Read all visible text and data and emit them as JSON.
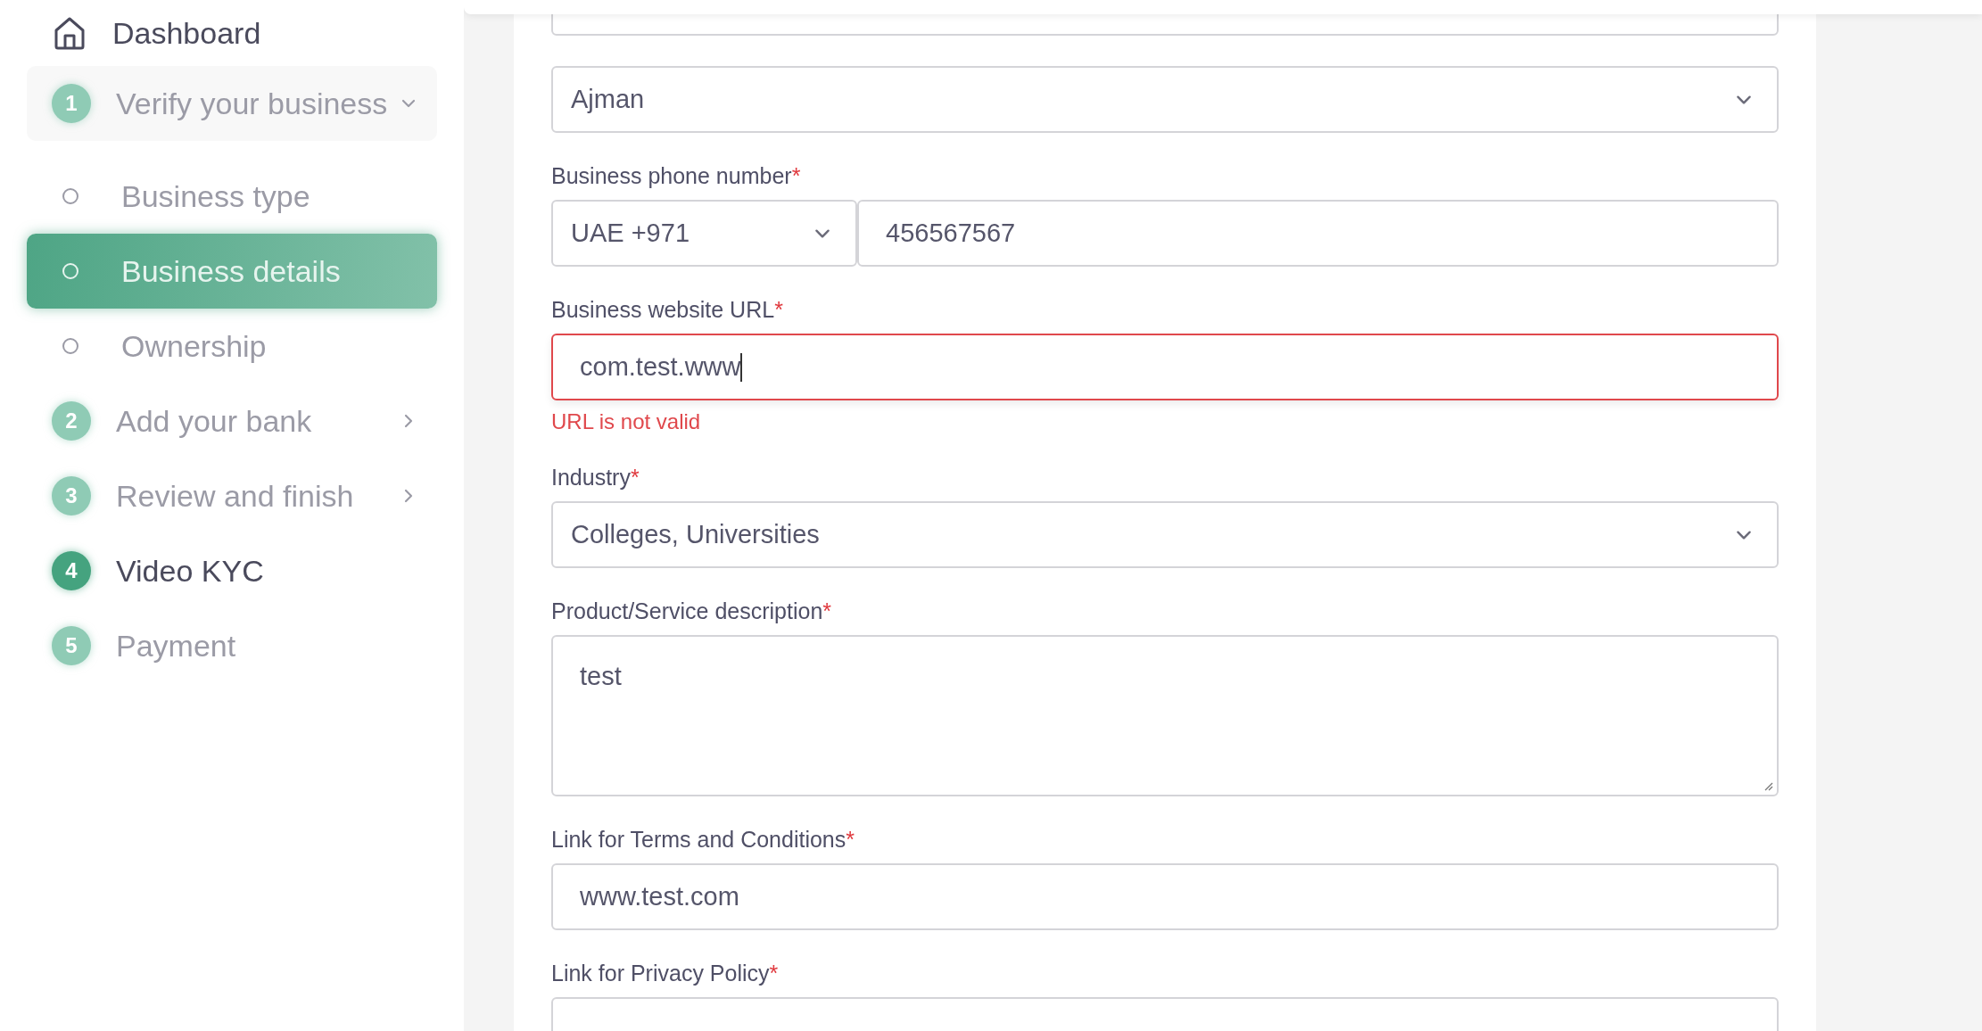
{
  "sidebar": {
    "dashboard": {
      "label": "Dashboard"
    },
    "steps": [
      {
        "kind": "group",
        "number": "1",
        "label": "Verify your business",
        "expanded": true,
        "active": false,
        "children": [
          {
            "label": "Business type",
            "selected": false
          },
          {
            "label": "Business details",
            "selected": true
          },
          {
            "label": "Ownership",
            "selected": false
          }
        ]
      },
      {
        "kind": "group",
        "number": "2",
        "label": "Add your bank",
        "expanded": false,
        "active": false
      },
      {
        "kind": "group",
        "number": "3",
        "label": "Review and finish",
        "expanded": false,
        "active": false
      },
      {
        "kind": "step",
        "number": "4",
        "label": "Video KYC",
        "active": true
      },
      {
        "kind": "step",
        "number": "5",
        "label": "Payment",
        "active": false
      }
    ]
  },
  "form": {
    "fields": [
      {
        "kind": "text"
      },
      {
        "kind": "select",
        "value": "Ajman"
      },
      {
        "kind": "phone",
        "label": "Business phone number",
        "required_mark": "*",
        "code": "UAE +971",
        "value": "456567567"
      },
      {
        "kind": "text",
        "label": "Business website URL",
        "required_mark": "*",
        "value": "com.test.www",
        "focused": true,
        "error": "URL is not valid"
      },
      {
        "kind": "select",
        "label": "Industry",
        "required_mark": "*",
        "value": "Colleges, Universities"
      },
      {
        "kind": "textarea",
        "label": "Product/Service description",
        "required_mark": "*",
        "value": "test"
      },
      {
        "kind": "text",
        "label": "Link for Terms and Conditions",
        "required_mark": "*",
        "value": "www.test.com"
      },
      {
        "kind": "text",
        "label": "Link for Privacy Policy",
        "required_mark": "*"
      }
    ]
  }
}
